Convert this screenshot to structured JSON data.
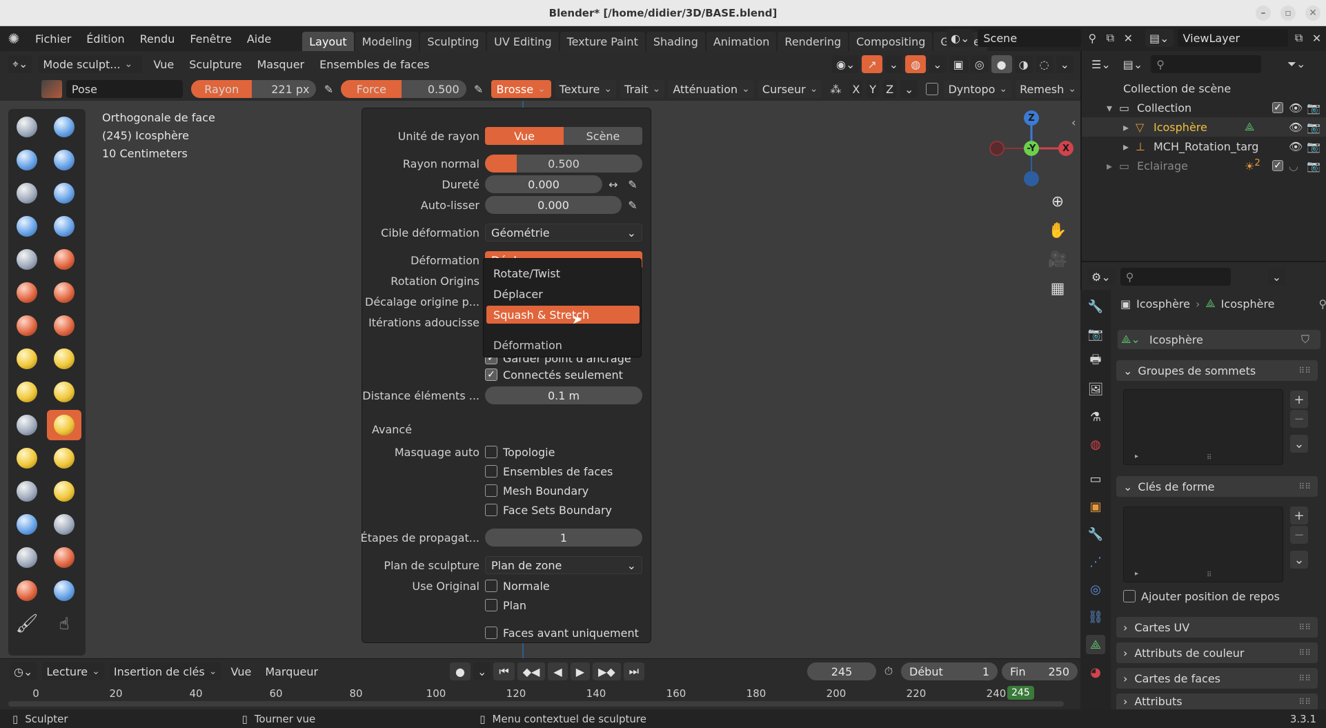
{
  "window": {
    "title": "Blender* [/home/didier/3D/BASE.blend]",
    "version": "3.3.1"
  },
  "menu": [
    "Fichier",
    "Édition",
    "Rendu",
    "Fenêtre",
    "Aide"
  ],
  "workspaces": [
    "Layout",
    "Modeling",
    "Sculpting",
    "UV Editing",
    "Texture Paint",
    "Shading",
    "Animation",
    "Rendering",
    "Compositing",
    "Geome"
  ],
  "scene": {
    "name": "Scene",
    "viewlayer": "ViewLayer"
  },
  "viewport_header": {
    "mode": "Mode sculpt...",
    "menus": [
      "Vue",
      "Sculpture",
      "Masquer",
      "Ensembles de faces"
    ]
  },
  "tool_header": {
    "brush_name": "Pose",
    "radius_label": "Rayon",
    "radius_value": "221 px",
    "strength_label": "Force",
    "strength_value": "0.500",
    "dropdowns": [
      "Brosse",
      "Texture",
      "Trait",
      "Atténuation",
      "Curseur"
    ],
    "axes": [
      "X",
      "Y",
      "Z"
    ],
    "dyntopo": "Dyntopo",
    "remesh": "Remesh"
  },
  "viewport_info": [
    "Orthogonale de face",
    "(245) Icosphère",
    "10 Centimeters"
  ],
  "brush_popup": {
    "radius_unit_label": "Unité de rayon",
    "radius_unit_options": [
      "Vue",
      "Scène"
    ],
    "normal_radius_label": "Rayon normal",
    "normal_radius_value": "0.500",
    "normal_radius_fill": 0.5,
    "hardness_label": "Dureté",
    "hardness_value": "0.000",
    "autosmooth_label": "Auto-lisser",
    "autosmooth_value": "0.000",
    "deform_target_label": "Cible déformation",
    "deform_target_value": "Géométrie",
    "deformation_label": "Déformation",
    "deformation_value": "Déplacer",
    "rotation_origins_label": "Rotation Origins",
    "origin_offset_label": "Décalage origine p...",
    "smooth_iterations_label": "Itérations adoucisse",
    "keep_anchor_label": "Garder point d'ancrage",
    "connected_only_label": "Connectés seulement",
    "element_distance_label": "Distance éléments ...",
    "element_distance_value": "0.1 m",
    "advanced_label": "Avancé",
    "auto_mask_label": "Masquage auto",
    "auto_mask_options": [
      "Topologie",
      "Ensembles de faces",
      "Mesh Boundary",
      "Face Sets Boundary"
    ],
    "propagation_label": "Étapes de propagat...",
    "propagation_value": "1",
    "sculpt_plane_label": "Plan de sculpture",
    "sculpt_plane_value": "Plan de zone",
    "use_original_label": "Use Original",
    "use_original_options": [
      "Normale",
      "Plan"
    ],
    "front_faces_label": "Faces avant uniquement"
  },
  "deformation_menu": {
    "items": [
      "Rotate/Twist",
      "Déplacer",
      "Squash & Stretch"
    ],
    "title": "Déformation",
    "highlighted": 2
  },
  "gizmo": {
    "z": "Z",
    "y": "-Y",
    "x": "X"
  },
  "timeline": {
    "menus": [
      "Lecture",
      "Insertion de clés",
      "Vue",
      "Marqueur"
    ],
    "current_frame": "245",
    "start_label": "Début",
    "start": "1",
    "end_label": "Fin",
    "end": "250",
    "ticks": [
      "0",
      "20",
      "40",
      "60",
      "80",
      "100",
      "120",
      "140",
      "160",
      "180",
      "200",
      "220",
      "240"
    ],
    "playhead": "245"
  },
  "outliner": {
    "root": "Collection de scène",
    "items": [
      {
        "name": "Collection",
        "level": 1
      },
      {
        "name": "Icosphère",
        "level": 2
      },
      {
        "name": "MCH_Rotation_targ",
        "level": 2
      },
      {
        "name": "Eclairage",
        "level": 1,
        "badge": "2"
      }
    ]
  },
  "properties": {
    "breadcrumb": [
      "Icosphère",
      "Icosphère"
    ],
    "data_name": "Icosphère",
    "panels": [
      "Groupes de sommets",
      "Clés de forme",
      "Cartes UV",
      "Attributs de couleur",
      "Cartes de faces",
      "Attributs"
    ],
    "rest_position_label": "Ajouter position de repos"
  },
  "status": {
    "left": "Sculpter",
    "middle": "Tourner vue",
    "right": "Menu contextuel de sculpture"
  },
  "colors": {
    "accent": "#e0653a",
    "highlight_text": "#f0c040"
  }
}
